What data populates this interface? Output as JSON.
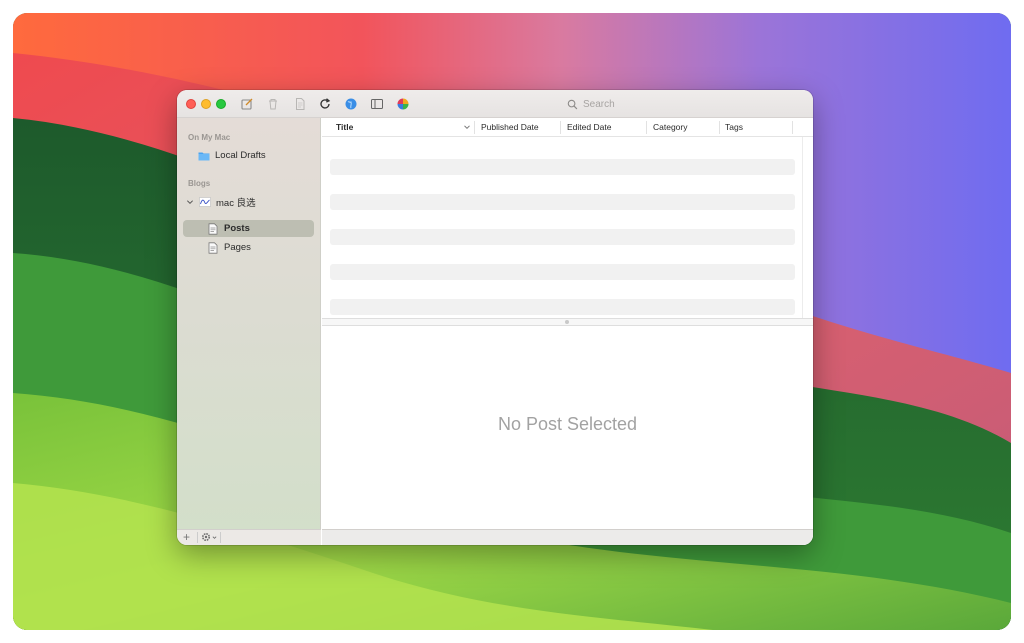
{
  "toolbar": {
    "icons": [
      "compose-icon",
      "trash-icon",
      "document-icon",
      "refresh-icon",
      "globe-icon",
      "sidebar-toggle-icon",
      "color-wheel-icon"
    ],
    "search_placeholder": "Search"
  },
  "sidebar": {
    "section_local": "On My Mac",
    "local_drafts": "Local Drafts",
    "section_blogs": "Blogs",
    "blog_name": "mac 良选",
    "posts": "Posts",
    "pages": "Pages",
    "add_label": "+"
  },
  "table": {
    "columns": [
      "Title",
      "Published Date",
      "Edited Date",
      "Category",
      "Tags"
    ]
  },
  "detail": {
    "empty_text": "No Post Selected"
  },
  "colors": {
    "close": "#ff5f57",
    "minimize": "#febc2e",
    "maximize": "#28c840",
    "folder": "#4aa3f0"
  }
}
